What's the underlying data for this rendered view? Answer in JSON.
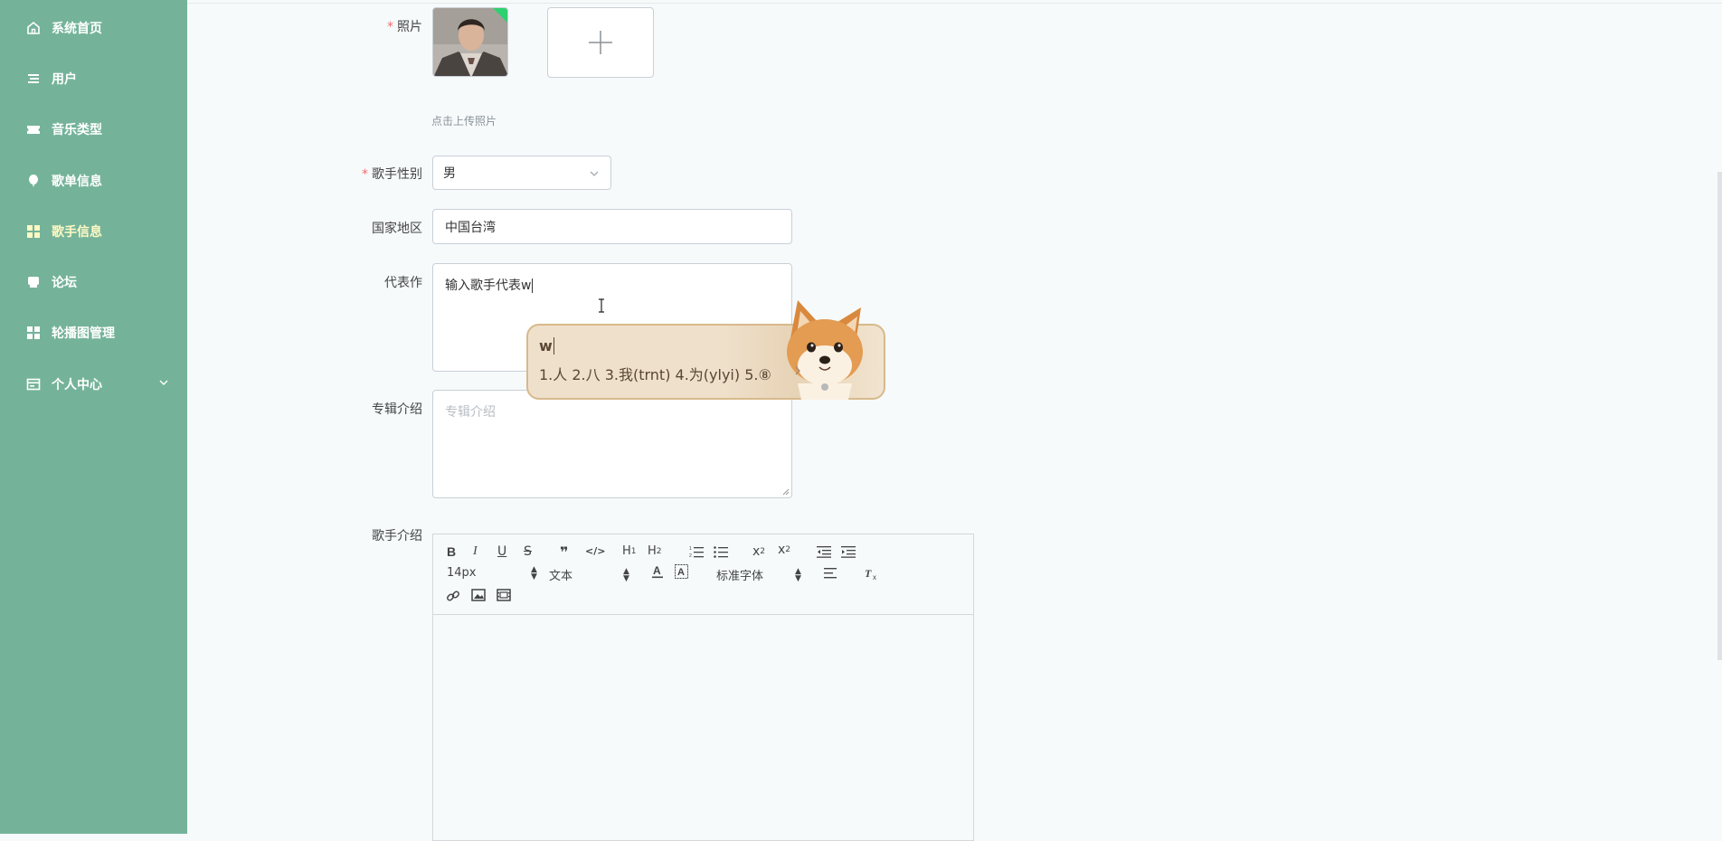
{
  "sidebar": {
    "items": [
      {
        "label": "系统首页",
        "icon": "home-icon"
      },
      {
        "label": "用户",
        "icon": "list-icon"
      },
      {
        "label": "音乐类型",
        "icon": "ticket-icon"
      },
      {
        "label": "歌单信息",
        "icon": "balloon-icon"
      },
      {
        "label": "歌手信息",
        "icon": "grid-icon",
        "active": true
      },
      {
        "label": "论坛",
        "icon": "chat-icon"
      },
      {
        "label": "轮播图管理",
        "icon": "grid-icon"
      },
      {
        "label": "个人中心",
        "icon": "card-icon",
        "expandable": true
      }
    ]
  },
  "form": {
    "photo": {
      "label": "照片",
      "required": true,
      "hint": "点击上传照片"
    },
    "gender": {
      "label": "歌手性别",
      "required": true,
      "value": "男"
    },
    "region": {
      "label": "国家地区",
      "value": "中国台湾"
    },
    "works": {
      "label": "代表作",
      "value": "输入歌手代表w"
    },
    "album": {
      "label": "专辑介绍",
      "placeholder": "专辑介绍"
    },
    "intro": {
      "label": "歌手介绍"
    }
  },
  "editor": {
    "font_size": "14px",
    "block_type": "文本",
    "font_family": "标准字体"
  },
  "ime": {
    "composition": "w",
    "candidates": "1.人  2.八  3.我(trnt)  4.为(ylyi)  5.⑧"
  },
  "colors": {
    "sidebar_bg": "#74b39a",
    "active_text": "#fff9c4",
    "required": "#f56c6c"
  }
}
